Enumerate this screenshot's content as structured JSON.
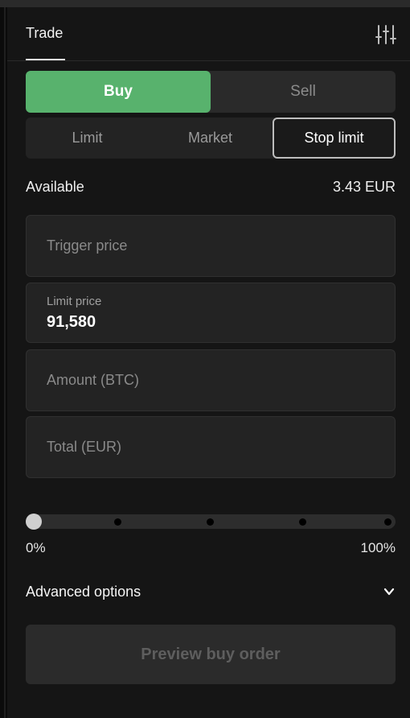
{
  "header": {
    "title": "Trade",
    "settings_icon": "sliders-icon"
  },
  "side": {
    "buy_label": "Buy",
    "sell_label": "Sell",
    "selected": "Buy"
  },
  "order_types": {
    "limit_label": "Limit",
    "market_label": "Market",
    "stop_limit_label": "Stop limit",
    "selected": "Stop limit"
  },
  "available": {
    "label": "Available",
    "value": "3.43 EUR"
  },
  "fields": {
    "trigger_price": {
      "placeholder": "Trigger price"
    },
    "limit_price": {
      "label": "Limit price",
      "value": "91,580"
    },
    "amount": {
      "placeholder": "Amount (BTC)"
    },
    "total": {
      "placeholder": "Total (EUR)"
    }
  },
  "slider": {
    "min_label": "0%",
    "max_label": "100%",
    "value_percent": 0
  },
  "advanced": {
    "label": "Advanced options",
    "icon": "chevron-down-icon"
  },
  "preview_button": {
    "label": "Preview buy order"
  },
  "colors": {
    "buy": "#58b26d",
    "panel": "#151515",
    "field": "#232323"
  }
}
